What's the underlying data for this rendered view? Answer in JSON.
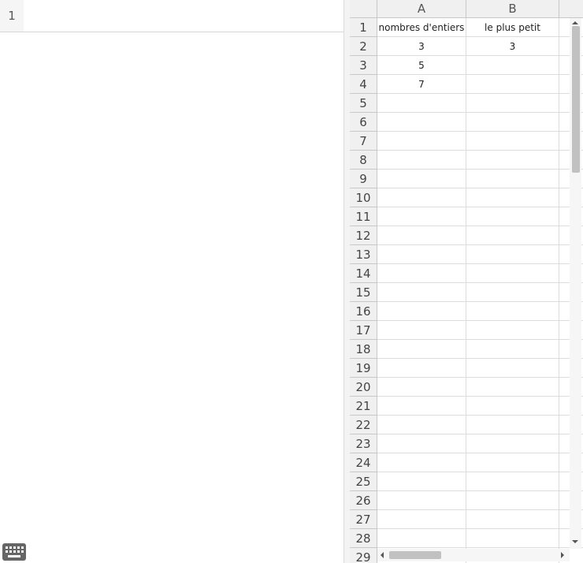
{
  "algebra": {
    "rows": [
      {
        "number": "1",
        "input": ""
      }
    ]
  },
  "spreadsheet": {
    "columns": [
      "A",
      "B"
    ],
    "rows": [
      {
        "number": "1",
        "cells": [
          "nombres d'entiers",
          "le plus petit"
        ]
      },
      {
        "number": "2",
        "cells": [
          "3",
          "3"
        ]
      },
      {
        "number": "3",
        "cells": [
          "5",
          ""
        ]
      },
      {
        "number": "4",
        "cells": [
          "7",
          ""
        ]
      },
      {
        "number": "5",
        "cells": [
          "",
          ""
        ]
      },
      {
        "number": "6",
        "cells": [
          "",
          ""
        ]
      },
      {
        "number": "7",
        "cells": [
          "",
          ""
        ]
      },
      {
        "number": "8",
        "cells": [
          "",
          ""
        ]
      },
      {
        "number": "9",
        "cells": [
          "",
          ""
        ]
      },
      {
        "number": "10",
        "cells": [
          "",
          ""
        ]
      },
      {
        "number": "11",
        "cells": [
          "",
          ""
        ]
      },
      {
        "number": "12",
        "cells": [
          "",
          ""
        ]
      },
      {
        "number": "13",
        "cells": [
          "",
          ""
        ]
      },
      {
        "number": "14",
        "cells": [
          "",
          ""
        ]
      },
      {
        "number": "15",
        "cells": [
          "",
          ""
        ]
      },
      {
        "number": "16",
        "cells": [
          "",
          ""
        ]
      },
      {
        "number": "17",
        "cells": [
          "",
          ""
        ]
      },
      {
        "number": "18",
        "cells": [
          "",
          ""
        ]
      },
      {
        "number": "19",
        "cells": [
          "",
          ""
        ]
      },
      {
        "number": "20",
        "cells": [
          "",
          ""
        ]
      },
      {
        "number": "21",
        "cells": [
          "",
          ""
        ]
      },
      {
        "number": "22",
        "cells": [
          "",
          ""
        ]
      },
      {
        "number": "23",
        "cells": [
          "",
          ""
        ]
      },
      {
        "number": "24",
        "cells": [
          "",
          ""
        ]
      },
      {
        "number": "25",
        "cells": [
          "",
          ""
        ]
      },
      {
        "number": "26",
        "cells": [
          "",
          ""
        ]
      },
      {
        "number": "27",
        "cells": [
          "",
          ""
        ]
      },
      {
        "number": "28",
        "cells": [
          "",
          ""
        ]
      },
      {
        "number": "29",
        "cells": [
          "",
          ""
        ]
      }
    ]
  },
  "icons": {
    "keyboard": "keyboard-icon"
  }
}
